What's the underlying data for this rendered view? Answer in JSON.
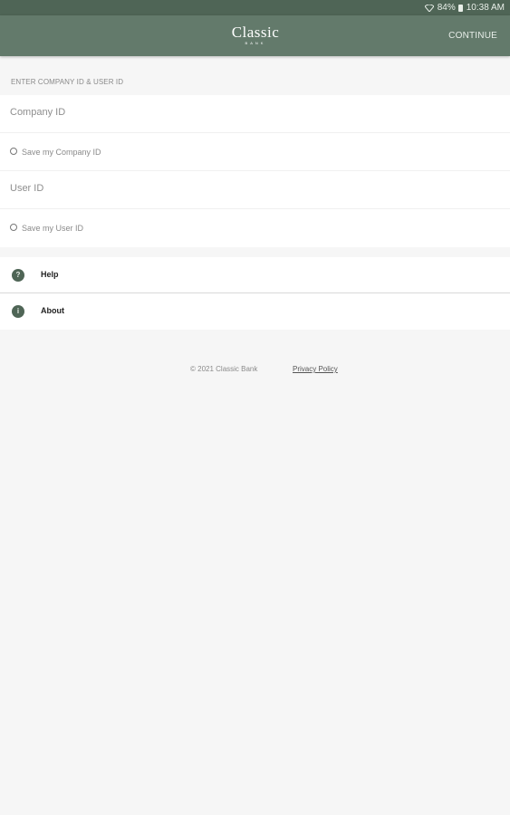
{
  "status_bar": {
    "battery": "84%",
    "time": "10:38 AM"
  },
  "app_bar": {
    "logo_main": "Classic",
    "logo_sub": "BANK",
    "continue_label": "CONTINUE",
    "background_color": "#637a6b"
  },
  "login": {
    "section_header": "ENTER COMPANY ID & USER ID",
    "company_id_placeholder": "Company ID",
    "company_id_value": "",
    "save_company_label": "Save my Company ID",
    "user_id_placeholder": "User ID",
    "user_id_value": "",
    "save_user_label": "Save my User ID"
  },
  "menu": {
    "items": [
      {
        "label": "Help",
        "icon": "help-icon",
        "glyph": "?"
      },
      {
        "label": "About",
        "icon": "info-icon",
        "glyph": "i"
      }
    ]
  },
  "footer": {
    "copyright": "© 2021 Classic Bank",
    "privacy_link": "Privacy Policy"
  }
}
